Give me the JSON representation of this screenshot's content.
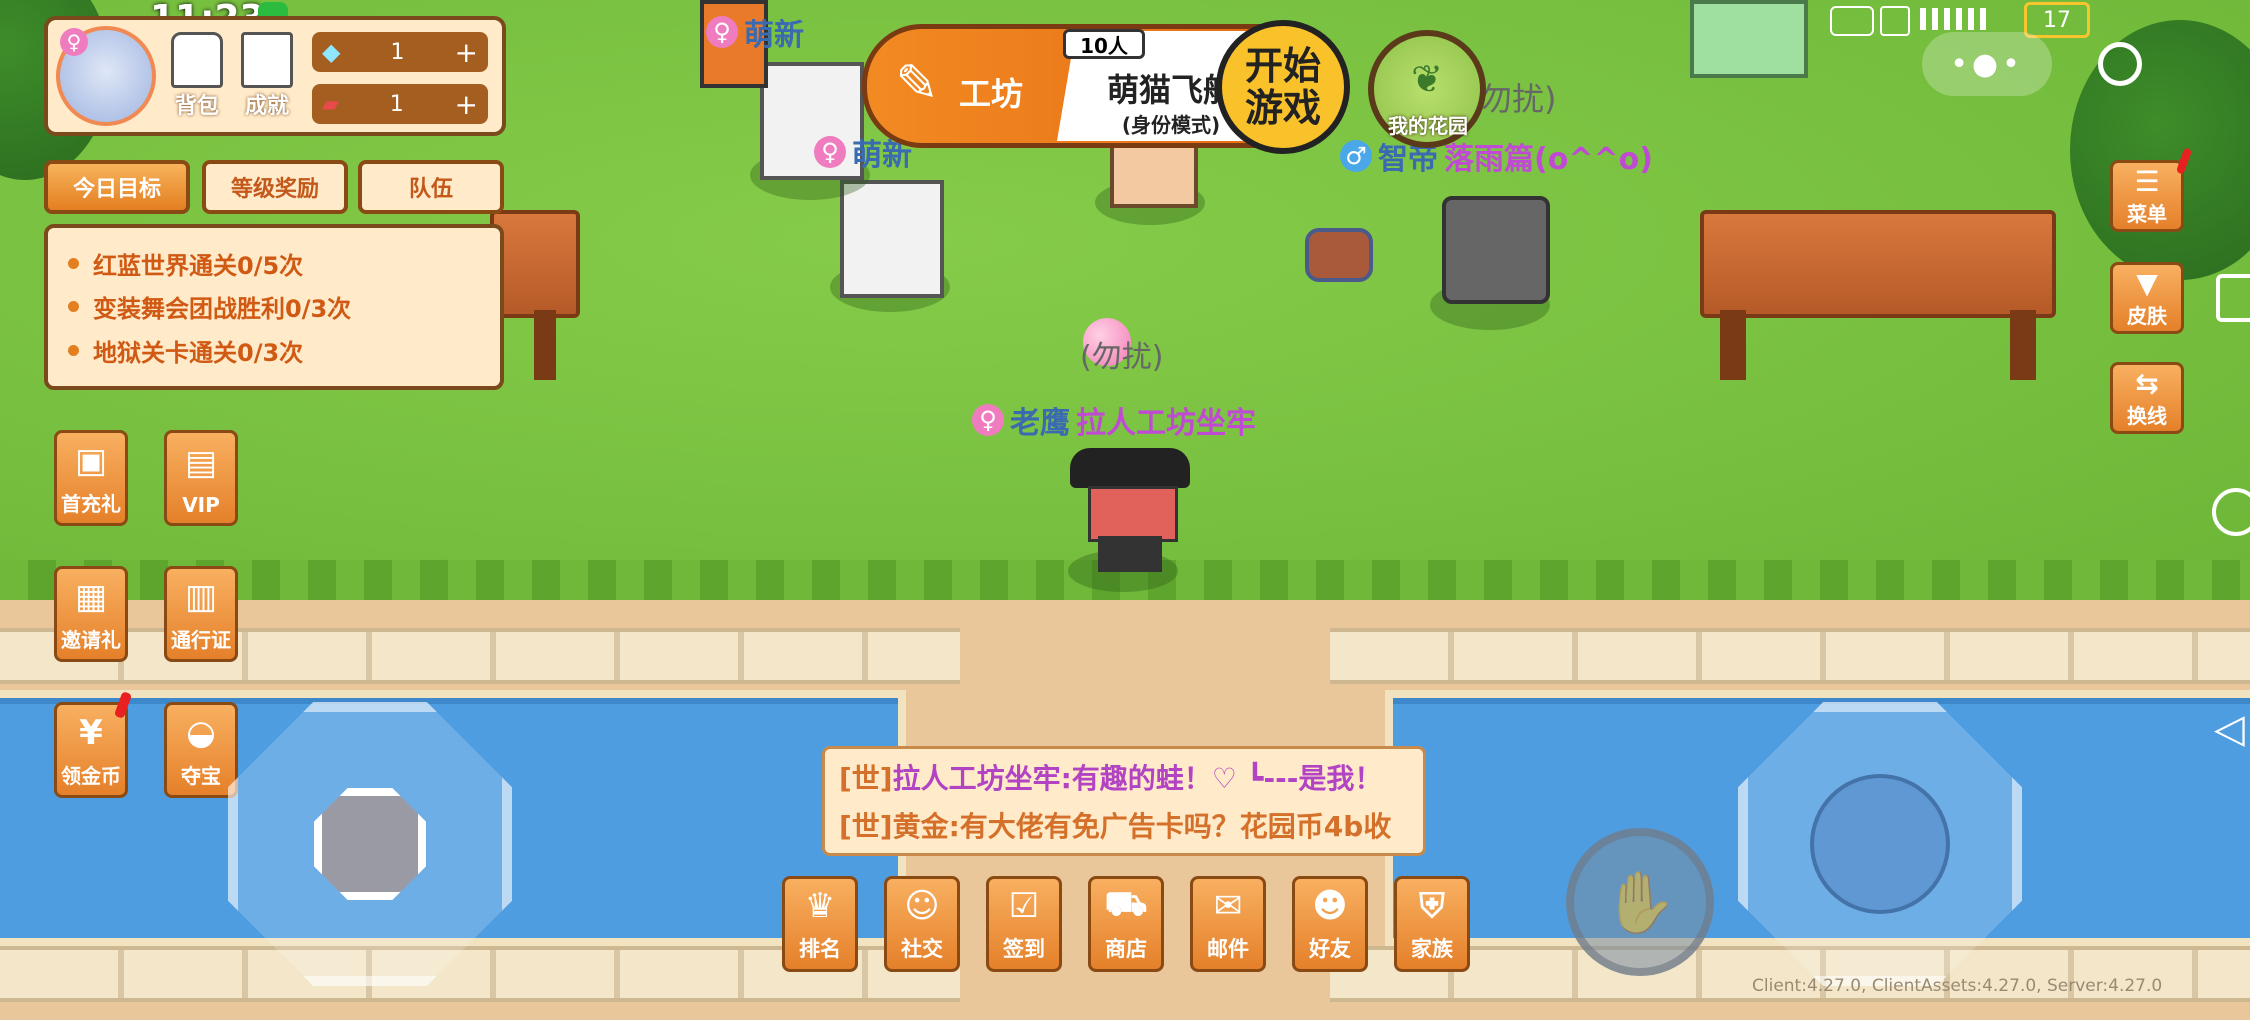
{
  "status_bar": {
    "time": "11:23",
    "battery": "17"
  },
  "resources": [
    {
      "icon": "diamond-icon",
      "value": "1"
    },
    {
      "icon": "ticket-icon",
      "value": "1"
    }
  ],
  "profile_buttons": {
    "bag": "背包",
    "achievement": "成就"
  },
  "tabs": [
    "今日目标",
    "等级奖励",
    "队伍"
  ],
  "goals": [
    "红蓝世界通关0/5次",
    "变装舞会团战胜利0/3次",
    "地狱关卡通关0/3次"
  ],
  "left_buttons": [
    {
      "label": "首充礼",
      "icon": "first-charge-icon"
    },
    {
      "label": "VIP",
      "icon": "vip-icon"
    },
    {
      "label": "邀请礼",
      "icon": "gift-icon"
    },
    {
      "label": "通行证",
      "icon": "pass-icon"
    },
    {
      "label": "领金币",
      "icon": "coin-icon"
    },
    {
      "label": "夺宝",
      "icon": "treasure-icon"
    }
  ],
  "banner": {
    "workshop": "工坊",
    "players": "10人",
    "title": "萌猫飞船",
    "mode": "(身份模式)",
    "start_line1": "开始",
    "start_line2": "游戏"
  },
  "garden": {
    "label": "我的花园"
  },
  "players": {
    "top_left_1": "萌新",
    "top_left_2": "萌新",
    "top_right_tag": "勿扰)",
    "male_player": {
      "tag": "智帝",
      "name": "落雨篇(o^^o)"
    },
    "main_player": {
      "bubble": "(勿扰)",
      "tag": "老鹰",
      "name": "拉人工坊坐牢"
    }
  },
  "right_buttons": [
    {
      "label": "菜单",
      "icon": "menu-icon"
    },
    {
      "label": "皮肤",
      "icon": "shirt-icon"
    },
    {
      "label": "换线",
      "icon": "switch-icon"
    }
  ],
  "chat": [
    {
      "channel": "[世]",
      "text": "拉人工坊坐牢:有趣的蛙！♡ ┗---是我！"
    },
    {
      "channel": "[世]",
      "text": "黄金:有大佬有免广告卡吗？花园币4b收"
    }
  ],
  "bottom_buttons": [
    {
      "label": "排名",
      "icon": "trophy-icon"
    },
    {
      "label": "社交",
      "icon": "chat-icon"
    },
    {
      "label": "签到",
      "icon": "calendar-icon"
    },
    {
      "label": "商店",
      "icon": "cart-icon"
    },
    {
      "label": "邮件",
      "icon": "mail-icon"
    },
    {
      "label": "好友",
      "icon": "friend-icon"
    },
    {
      "label": "家族",
      "icon": "family-icon"
    }
  ],
  "version": "Client:4.27.0, ClientAssets:4.27.0, Server:4.27.0",
  "colors": {
    "accent": "#e88a26",
    "panel": "#ffeac9",
    "border": "#7a4a1d",
    "grass": "#7cc443",
    "water": "#4f9de1"
  }
}
